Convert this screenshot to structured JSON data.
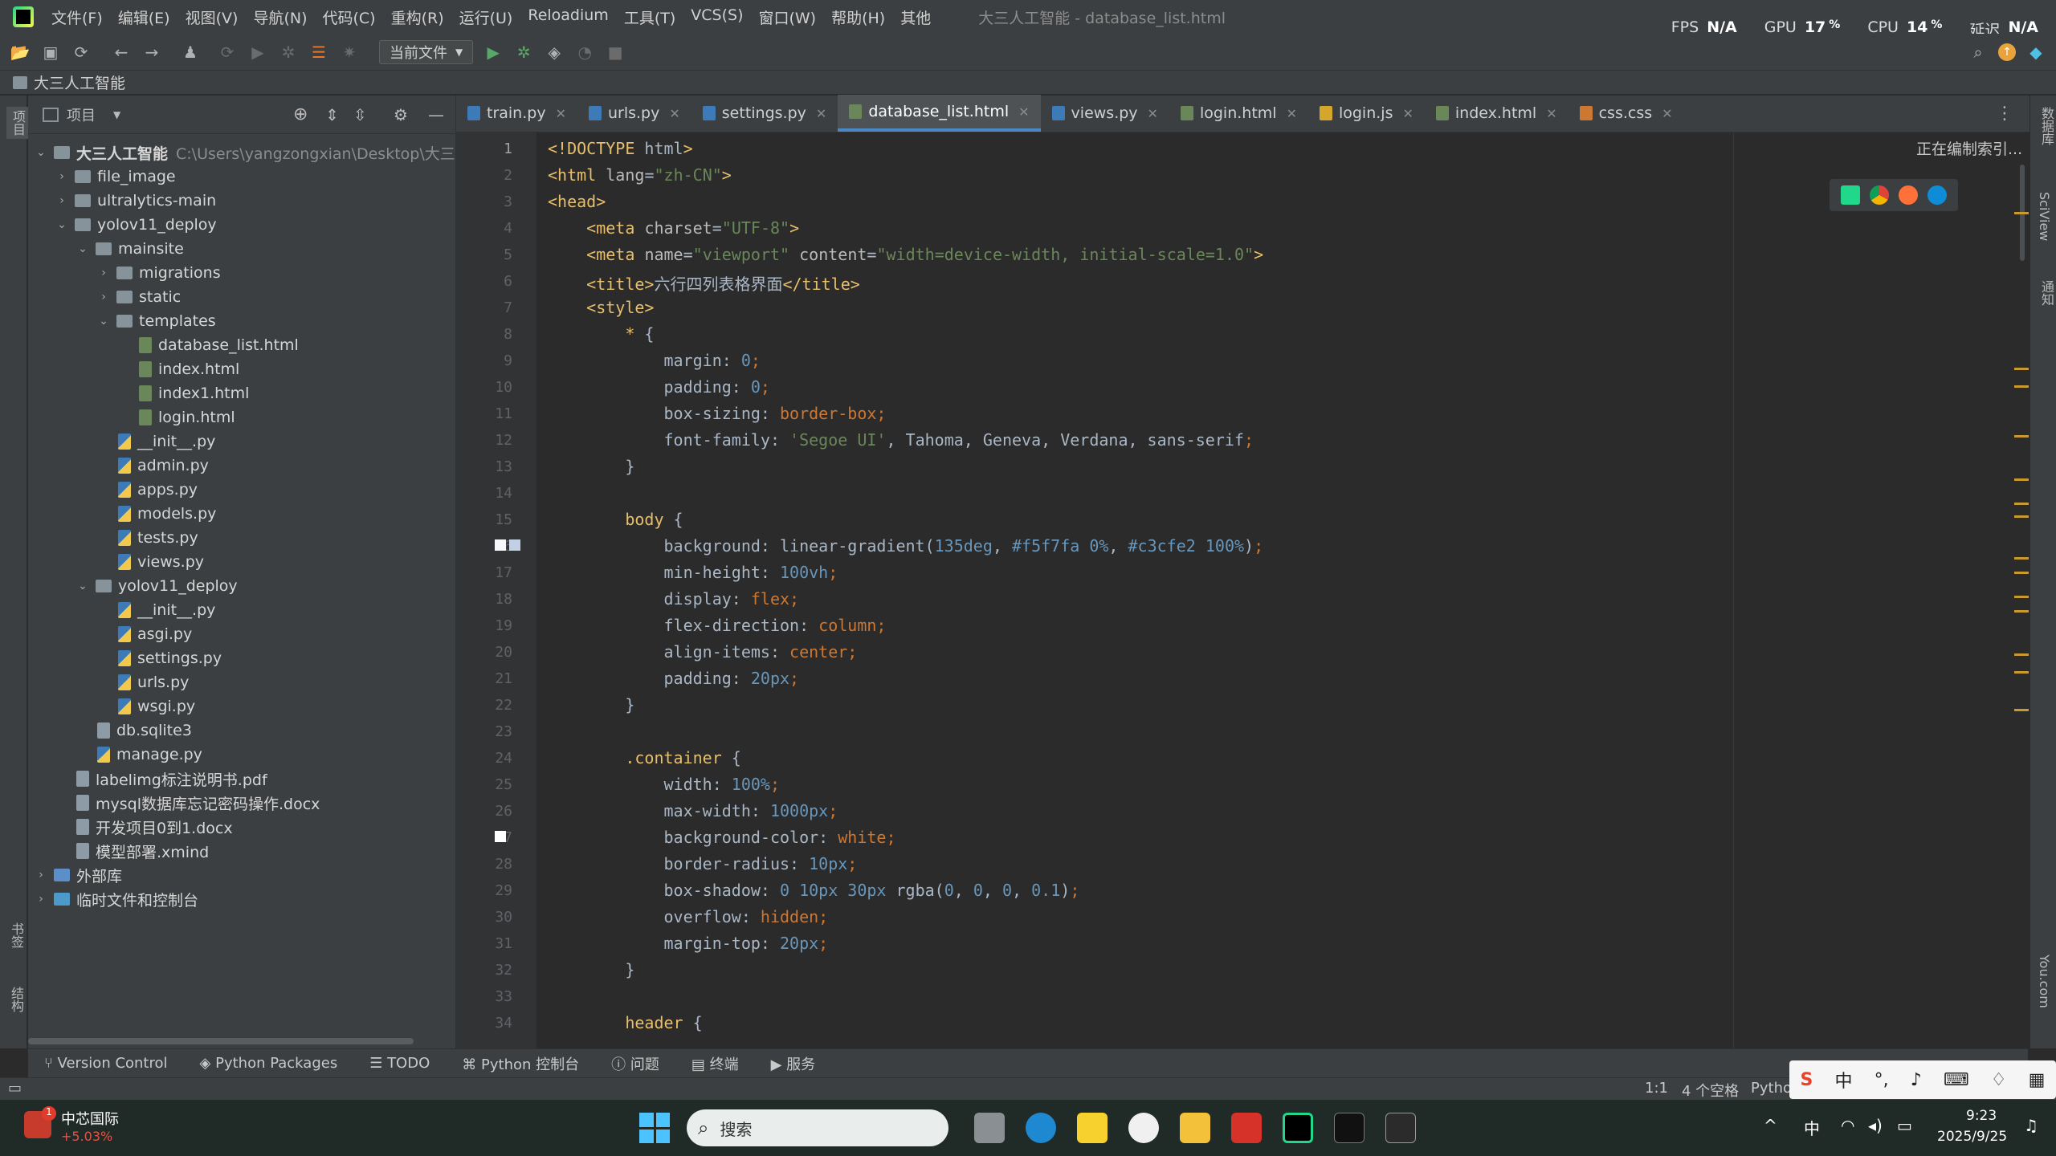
{
  "menubar": {
    "items": [
      "文件(F)",
      "编辑(E)",
      "视图(V)",
      "导航(N)",
      "代码(C)",
      "重构(R)",
      "运行(U)",
      "Reloadium",
      "工具(T)",
      "VCS(S)",
      "窗口(W)",
      "帮助(H)",
      "其他"
    ],
    "title": "大三人工智能 - database_list.html"
  },
  "stats": {
    "fps_label": "FPS",
    "fps_value": "N/A",
    "gpu_label": "GPU",
    "gpu_value": "17",
    "cpu_label": "CPU",
    "cpu_value": "14",
    "latency_label": "延迟",
    "latency_value": "N/A",
    "percent": "%"
  },
  "toolbar": {
    "run_config": "当前文件"
  },
  "navbar": {
    "project_name": "大三人工智能"
  },
  "project_panel": {
    "title": "项目",
    "root_path": "C:\\Users\\yangzongxian\\Desktop\\大三人工",
    "tree": [
      {
        "label": "大三人工智能",
        "type": "folder",
        "depth": 0,
        "open": true,
        "bold": true
      },
      {
        "label": "file_image",
        "type": "folder",
        "depth": 1,
        "open": false
      },
      {
        "label": "ultralytics-main",
        "type": "folder",
        "depth": 1,
        "open": false
      },
      {
        "label": "yolov11_deploy",
        "type": "folder",
        "depth": 1,
        "open": true
      },
      {
        "label": "mainsite",
        "type": "folder",
        "depth": 2,
        "open": true
      },
      {
        "label": "migrations",
        "type": "folder",
        "depth": 3,
        "open": false
      },
      {
        "label": "static",
        "type": "folder",
        "depth": 3,
        "open": false
      },
      {
        "label": "templates",
        "type": "folder",
        "depth": 3,
        "open": true
      },
      {
        "label": "database_list.html",
        "type": "html",
        "depth": 4
      },
      {
        "label": "index.html",
        "type": "html",
        "depth": 4
      },
      {
        "label": "index1.html",
        "type": "html",
        "depth": 4
      },
      {
        "label": "login.html",
        "type": "html",
        "depth": 4
      },
      {
        "label": "__init__.py",
        "type": "py",
        "depth": 3
      },
      {
        "label": "admin.py",
        "type": "py",
        "depth": 3
      },
      {
        "label": "apps.py",
        "type": "py",
        "depth": 3
      },
      {
        "label": "models.py",
        "type": "py",
        "depth": 3
      },
      {
        "label": "tests.py",
        "type": "py",
        "depth": 3
      },
      {
        "label": "views.py",
        "type": "py",
        "depth": 3
      },
      {
        "label": "yolov11_deploy",
        "type": "folder",
        "depth": 2,
        "open": true
      },
      {
        "label": "__init__.py",
        "type": "py",
        "depth": 3
      },
      {
        "label": "asgi.py",
        "type": "py",
        "depth": 3
      },
      {
        "label": "settings.py",
        "type": "py",
        "depth": 3
      },
      {
        "label": "urls.py",
        "type": "py",
        "depth": 3
      },
      {
        "label": "wsgi.py",
        "type": "py",
        "depth": 3
      },
      {
        "label": "db.sqlite3",
        "type": "other",
        "depth": 2
      },
      {
        "label": "manage.py",
        "type": "py",
        "depth": 2
      },
      {
        "label": "labelimg标注说明书.pdf",
        "type": "other",
        "depth": 1
      },
      {
        "label": "mysql数据库忘记密码操作.docx",
        "type": "other",
        "depth": 1
      },
      {
        "label": "开发项目0到1.docx",
        "type": "other",
        "depth": 1
      },
      {
        "label": "模型部署.xmind",
        "type": "other",
        "depth": 1
      },
      {
        "label": "外部库",
        "type": "lib",
        "depth": 0,
        "open": false
      },
      {
        "label": "临时文件和控制台",
        "type": "scratch",
        "depth": 0,
        "open": false
      }
    ]
  },
  "tabs": [
    "train.py",
    "urls.py",
    "settings.py",
    "database_list.html",
    "views.py",
    "login.html",
    "login.js",
    "index.html",
    "css.css"
  ],
  "editor": {
    "indexing": "正在编制索引...",
    "lines": [
      "<!DOCTYPE html>",
      "<html lang=\"zh-CN\">",
      "<head>",
      "    <meta charset=\"UTF-8\">",
      "    <meta name=\"viewport\" content=\"width=device-width, initial-scale=1.0\">",
      "    <title>六行四列表格界面</title>",
      "    <style>",
      "        * {",
      "            margin: 0;",
      "            padding: 0;",
      "            box-sizing: border-box;",
      "            font-family: 'Segoe UI', Tahoma, Geneva, Verdana, sans-serif;",
      "        }",
      "",
      "        body {",
      "            background: linear-gradient(135deg, #f5f7fa 0%, #c3cfe2 100%);",
      "            min-height: 100vh;",
      "            display: flex;",
      "            flex-direction: column;",
      "            align-items: center;",
      "            padding: 20px;",
      "        }",
      "",
      "        .container {",
      "            width: 100%;",
      "            max-width: 1000px;",
      "            background-color: white;",
      "            border-radius: 10px;",
      "            box-shadow: 0 10px 30px rgba(0, 0, 0, 0.1);",
      "            overflow: hidden;",
      "            margin-top: 20px;",
      "        }",
      "",
      "        header {"
    ]
  },
  "left_strip": {
    "top": "项目",
    "bookmarks": "书签",
    "structure": "结构"
  },
  "right_strip": {
    "database": "数据库",
    "sciview": "SciView",
    "notifications": "通知",
    "you": "You.com"
  },
  "bottom_tools": [
    "Version Control",
    "Python Packages",
    "TODO",
    "Python 控制台",
    "问题",
    "终端",
    "服务"
  ],
  "status": {
    "pos": "1:1",
    "indent": "4 个空格",
    "interp": "Pytho"
  },
  "taskbar": {
    "stock_name": "中芯国际",
    "stock_change": "+5.03%",
    "stock_badge": "1",
    "search": "搜索",
    "ime": "中",
    "time": "9:23",
    "date": "2025/9/25"
  },
  "colors": {
    "accent": "#4a88c7",
    "bg": "#2b2b2b",
    "panel": "#3c3f41"
  }
}
